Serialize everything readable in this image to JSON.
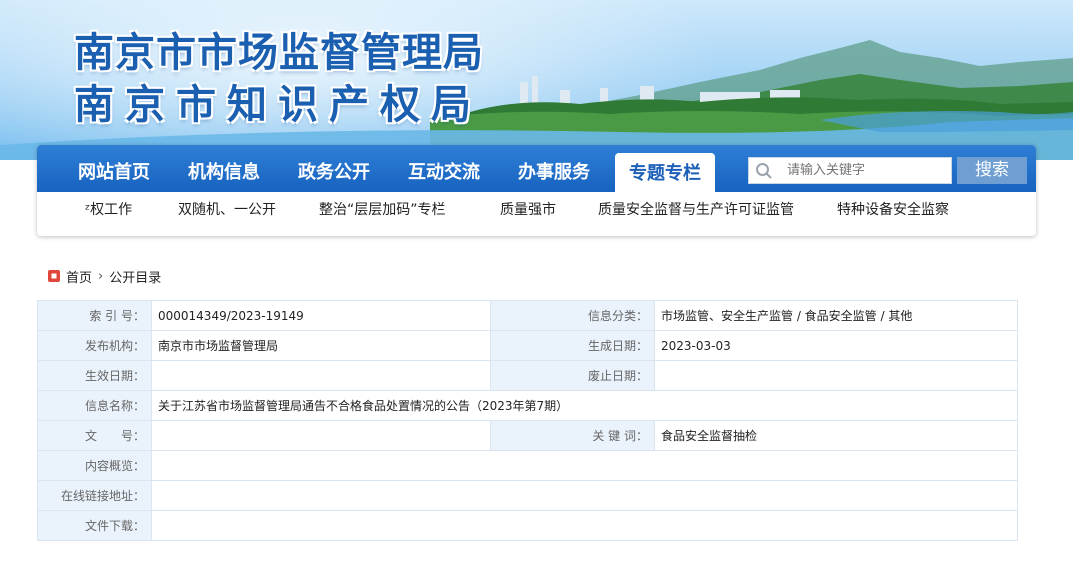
{
  "banner": {
    "title_line1": "南京市市场监督管理局",
    "title_line2": "南京市知识产权局"
  },
  "nav": {
    "items": [
      {
        "label": "网站首页"
      },
      {
        "label": "机构信息"
      },
      {
        "label": "政务公开"
      },
      {
        "label": "互动交流"
      },
      {
        "label": "办事服务"
      },
      {
        "label": "专题专栏",
        "active": true
      }
    ],
    "search": {
      "placeholder": "请输入关键字",
      "button": "搜索",
      "icon": "search-icon"
    }
  },
  "subnav": {
    "items": [
      {
        "label": "ᶻ权工作"
      },
      {
        "label": "双随机、一公开"
      },
      {
        "label": "整治“层层加码”专栏"
      },
      {
        "label": "质量强市"
      },
      {
        "label": "质量安全监督与生产许可证监管"
      },
      {
        "label": "特种设备安全监察"
      }
    ]
  },
  "breadcrumb": {
    "home": "首页",
    "current": "公开目录"
  },
  "info": {
    "index_label": "索 引 号：",
    "index_value": "000014349/2023-19149",
    "category_label": "信息分类：",
    "category_value": "市场监管、安全生产监管 / 食品安全监管 / 其他",
    "publisher_label": "发布机构：",
    "publisher_value": "南京市市场监督管理局",
    "created_label": "生成日期：",
    "created_value": "2023-03-03",
    "effective_label": "生效日期：",
    "effective_value": "",
    "abolished_label": "废止日期：",
    "abolished_value": "",
    "name_label": "信息名称：",
    "name_value": "关于江苏省市场监督管理局通告不合格食品处置情况的公告（2023年第7期）",
    "docno_label": "文　　号：",
    "docno_value": "",
    "keyword_label": "关 键 词：",
    "keyword_value": "食品安全监督抽检",
    "summary_label": "内容概览：",
    "summary_value": "",
    "link_label": "在线链接地址：",
    "link_value": "",
    "download_label": "文件下载：",
    "download_value": ""
  },
  "colors": {
    "nav_bg": "#1b68c6",
    "title_blue": "#1a5fb0",
    "label_bg": "#eaf2fb",
    "search_button": "#6f9ed3"
  }
}
